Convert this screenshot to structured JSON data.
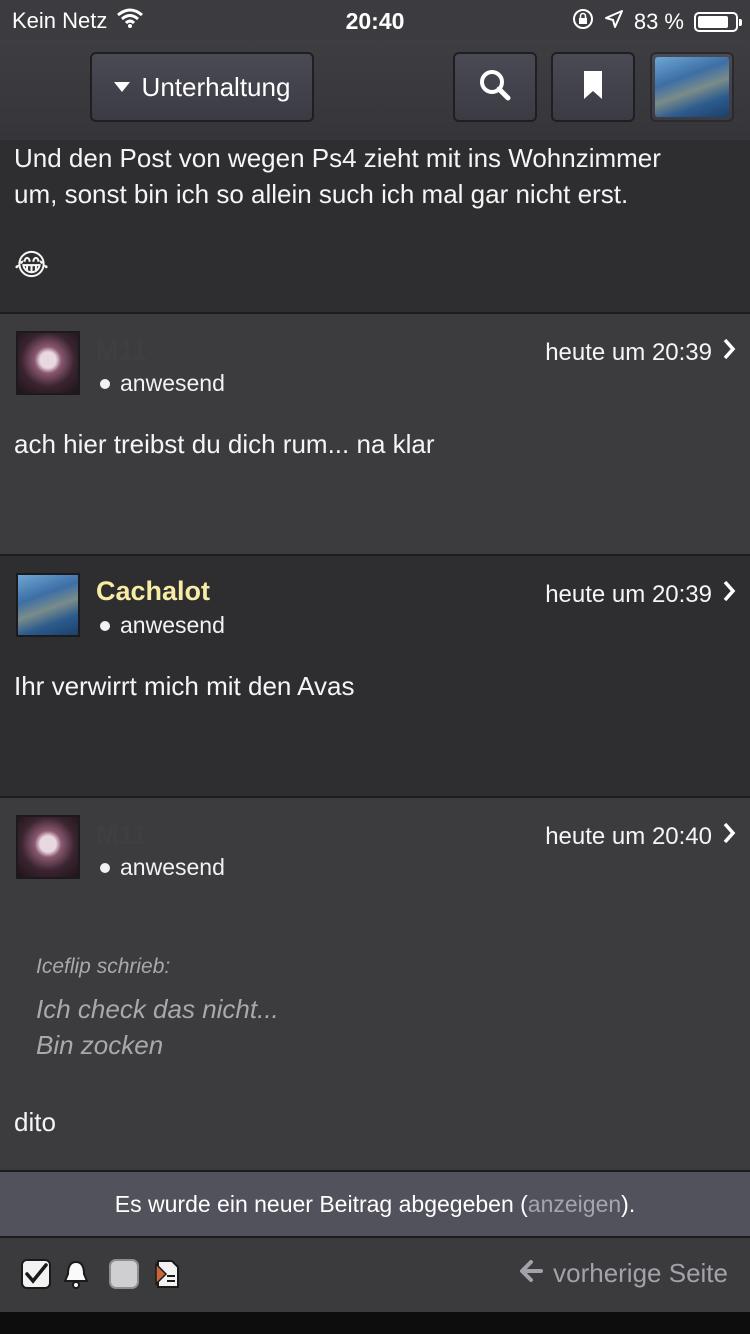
{
  "status_bar": {
    "carrier": "Kein Netz",
    "time": "20:40",
    "battery_text": "83 %",
    "battery_level": 0.83
  },
  "nav": {
    "dropdown_label": "Unterhaltung",
    "icons": [
      "search-icon",
      "bookmark-icon",
      "avatar"
    ]
  },
  "posts": [
    {
      "text_lines": [
        "Und den Post von wegen Ps4 zieht mit ins Wohnzimmer",
        "um, sonst bin ich so allein such ich mal gar nicht erst."
      ],
      "emoji": "😂"
    },
    {
      "username": "M11",
      "status": "anwesend",
      "timestamp": "heute um 20:39",
      "text": "ach hier treibst du dich rum... na klar"
    },
    {
      "username": "Cachalot",
      "status": "anwesend",
      "timestamp": "heute um 20:39",
      "text": "Ihr verwirrt mich mit den Avas"
    },
    {
      "username": "M11",
      "status": "anwesend",
      "timestamp": "heute um 20:40",
      "quote": {
        "author": "Iceflip schrieb:",
        "lines": [
          "Ich check das nicht...",
          "Bin zocken"
        ]
      },
      "text": "dito"
    }
  ],
  "banner": {
    "before": "Es wurde ein neuer Beitrag abgegeben (",
    "link": "anzeigen",
    "after": ")."
  },
  "toolbar": {
    "prev_page": "vorherige Seite",
    "icons": [
      "checkbox-checked-icon",
      "bell-icon",
      "square-icon",
      "document-icon"
    ]
  },
  "colors": {
    "username_highlight": "#f7eca4",
    "background": "#3a3a3c"
  }
}
